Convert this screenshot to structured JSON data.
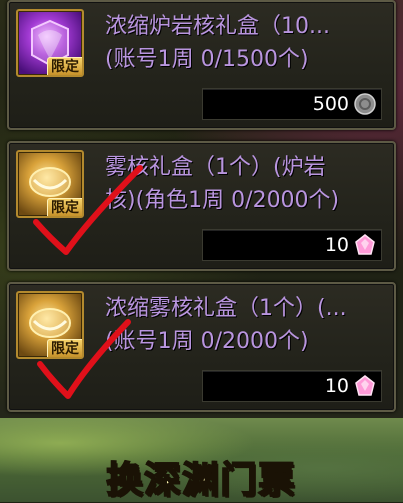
{
  "items": [
    {
      "title_line1": "浓缩炉岩核礼盒（10...",
      "title_line2": "(账号1周 0/1500个)",
      "badge": "限定",
      "price": "500",
      "currency_icon": "gray-coin-icon",
      "icon": "purple-crystal-box-icon"
    },
    {
      "title_line1": "雾核礼盒（1个）(炉岩",
      "title_line2": "核)(角色1周 0/2000个)",
      "badge": "限定",
      "price": "10",
      "currency_icon": "pink-gem-icon",
      "icon": "gold-box-icon"
    },
    {
      "title_line1": "浓缩雾核礼盒（1个）(...",
      "title_line2": "(账号1周 0/2000个)",
      "badge": "限定",
      "price": "10",
      "currency_icon": "pink-gem-icon",
      "icon": "gold-box-icon"
    }
  ],
  "caption": "换深渊门票",
  "colors": {
    "title": "#b995df",
    "check_mark": "#e0101a",
    "badge": "#f6d36b",
    "caption": "#fff7b0"
  }
}
